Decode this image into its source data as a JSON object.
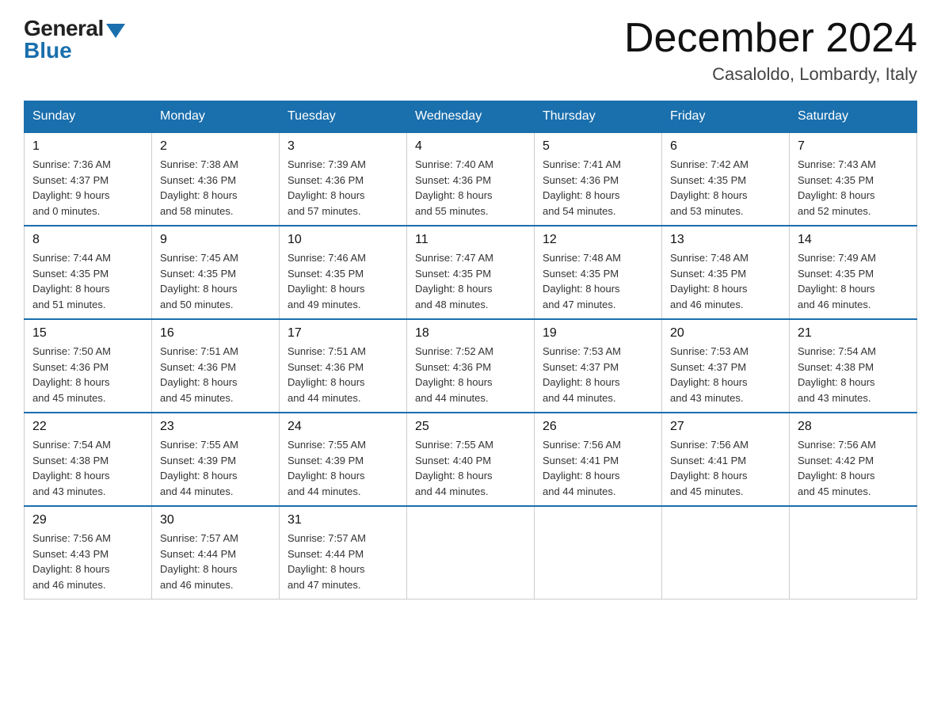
{
  "header": {
    "logo_general": "General",
    "logo_blue": "Blue",
    "month_year": "December 2024",
    "location": "Casaloldo, Lombardy, Italy"
  },
  "days_of_week": [
    "Sunday",
    "Monday",
    "Tuesday",
    "Wednesday",
    "Thursday",
    "Friday",
    "Saturday"
  ],
  "weeks": [
    [
      {
        "day": "1",
        "sunrise": "7:36 AM",
        "sunset": "4:37 PM",
        "daylight": "9 hours and 0 minutes."
      },
      {
        "day": "2",
        "sunrise": "7:38 AM",
        "sunset": "4:36 PM",
        "daylight": "8 hours and 58 minutes."
      },
      {
        "day": "3",
        "sunrise": "7:39 AM",
        "sunset": "4:36 PM",
        "daylight": "8 hours and 57 minutes."
      },
      {
        "day": "4",
        "sunrise": "7:40 AM",
        "sunset": "4:36 PM",
        "daylight": "8 hours and 55 minutes."
      },
      {
        "day": "5",
        "sunrise": "7:41 AM",
        "sunset": "4:36 PM",
        "daylight": "8 hours and 54 minutes."
      },
      {
        "day": "6",
        "sunrise": "7:42 AM",
        "sunset": "4:35 PM",
        "daylight": "8 hours and 53 minutes."
      },
      {
        "day": "7",
        "sunrise": "7:43 AM",
        "sunset": "4:35 PM",
        "daylight": "8 hours and 52 minutes."
      }
    ],
    [
      {
        "day": "8",
        "sunrise": "7:44 AM",
        "sunset": "4:35 PM",
        "daylight": "8 hours and 51 minutes."
      },
      {
        "day": "9",
        "sunrise": "7:45 AM",
        "sunset": "4:35 PM",
        "daylight": "8 hours and 50 minutes."
      },
      {
        "day": "10",
        "sunrise": "7:46 AM",
        "sunset": "4:35 PM",
        "daylight": "8 hours and 49 minutes."
      },
      {
        "day": "11",
        "sunrise": "7:47 AM",
        "sunset": "4:35 PM",
        "daylight": "8 hours and 48 minutes."
      },
      {
        "day": "12",
        "sunrise": "7:48 AM",
        "sunset": "4:35 PM",
        "daylight": "8 hours and 47 minutes."
      },
      {
        "day": "13",
        "sunrise": "7:48 AM",
        "sunset": "4:35 PM",
        "daylight": "8 hours and 46 minutes."
      },
      {
        "day": "14",
        "sunrise": "7:49 AM",
        "sunset": "4:35 PM",
        "daylight": "8 hours and 46 minutes."
      }
    ],
    [
      {
        "day": "15",
        "sunrise": "7:50 AM",
        "sunset": "4:36 PM",
        "daylight": "8 hours and 45 minutes."
      },
      {
        "day": "16",
        "sunrise": "7:51 AM",
        "sunset": "4:36 PM",
        "daylight": "8 hours and 45 minutes."
      },
      {
        "day": "17",
        "sunrise": "7:51 AM",
        "sunset": "4:36 PM",
        "daylight": "8 hours and 44 minutes."
      },
      {
        "day": "18",
        "sunrise": "7:52 AM",
        "sunset": "4:36 PM",
        "daylight": "8 hours and 44 minutes."
      },
      {
        "day": "19",
        "sunrise": "7:53 AM",
        "sunset": "4:37 PM",
        "daylight": "8 hours and 44 minutes."
      },
      {
        "day": "20",
        "sunrise": "7:53 AM",
        "sunset": "4:37 PM",
        "daylight": "8 hours and 43 minutes."
      },
      {
        "day": "21",
        "sunrise": "7:54 AM",
        "sunset": "4:38 PM",
        "daylight": "8 hours and 43 minutes."
      }
    ],
    [
      {
        "day": "22",
        "sunrise": "7:54 AM",
        "sunset": "4:38 PM",
        "daylight": "8 hours and 43 minutes."
      },
      {
        "day": "23",
        "sunrise": "7:55 AM",
        "sunset": "4:39 PM",
        "daylight": "8 hours and 44 minutes."
      },
      {
        "day": "24",
        "sunrise": "7:55 AM",
        "sunset": "4:39 PM",
        "daylight": "8 hours and 44 minutes."
      },
      {
        "day": "25",
        "sunrise": "7:55 AM",
        "sunset": "4:40 PM",
        "daylight": "8 hours and 44 minutes."
      },
      {
        "day": "26",
        "sunrise": "7:56 AM",
        "sunset": "4:41 PM",
        "daylight": "8 hours and 44 minutes."
      },
      {
        "day": "27",
        "sunrise": "7:56 AM",
        "sunset": "4:41 PM",
        "daylight": "8 hours and 45 minutes."
      },
      {
        "day": "28",
        "sunrise": "7:56 AM",
        "sunset": "4:42 PM",
        "daylight": "8 hours and 45 minutes."
      }
    ],
    [
      {
        "day": "29",
        "sunrise": "7:56 AM",
        "sunset": "4:43 PM",
        "daylight": "8 hours and 46 minutes."
      },
      {
        "day": "30",
        "sunrise": "7:57 AM",
        "sunset": "4:44 PM",
        "daylight": "8 hours and 46 minutes."
      },
      {
        "day": "31",
        "sunrise": "7:57 AM",
        "sunset": "4:44 PM",
        "daylight": "8 hours and 47 minutes."
      },
      null,
      null,
      null,
      null
    ]
  ]
}
